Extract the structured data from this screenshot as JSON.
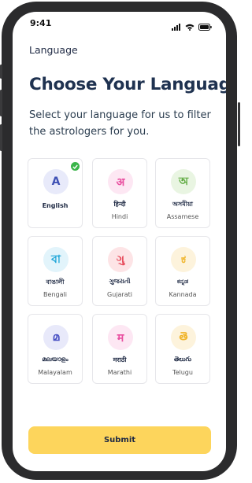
{
  "status_bar": {
    "time": "9:41"
  },
  "header": {
    "title": "Language"
  },
  "page": {
    "heading": "Choose Your Language",
    "subtitle": "Select your language for us to filter the astrologers for you."
  },
  "languages": [
    {
      "glyph": "A",
      "native": "",
      "english": "English",
      "selected": true,
      "accent": "#3f51b5",
      "bg": "#e8eafa"
    },
    {
      "glyph": "अ",
      "native": "हिन्दी",
      "english": "Hindi",
      "selected": false,
      "accent": "#e94fa0",
      "bg": "#fde7f3"
    },
    {
      "glyph": "অ",
      "native": "অসমীয়া",
      "english": "Assamese",
      "selected": false,
      "accent": "#5aa83b",
      "bg": "#e9f5e2"
    },
    {
      "glyph": "বা",
      "native": "বাঙালী",
      "english": "Bengali",
      "selected": false,
      "accent": "#1fa6d8",
      "bg": "#e2f4fb"
    },
    {
      "glyph": "ગુ",
      "native": "ગુજરાતી",
      "english": "Gujarati",
      "selected": false,
      "accent": "#e74c5c",
      "bg": "#fde4e6"
    },
    {
      "glyph": "ಕ",
      "native": "ಕನ್ನಡ",
      "english": "Kannada",
      "selected": false,
      "accent": "#f0b429",
      "bg": "#fdf3dc"
    },
    {
      "glyph": "മ",
      "native": "മലയാളം",
      "english": "Malayalam",
      "selected": false,
      "accent": "#4a52c4",
      "bg": "#e8e9fa"
    },
    {
      "glyph": "म",
      "native": "मराठी",
      "english": "Marathi",
      "selected": false,
      "accent": "#e94fa0",
      "bg": "#fde7f3"
    },
    {
      "glyph": "తె",
      "native": "తెలుగు",
      "english": "Telugu",
      "selected": false,
      "accent": "#f0b429",
      "bg": "#fdf3dc"
    }
  ],
  "actions": {
    "submit_label": "Submit"
  },
  "colors": {
    "submit_bg": "#fdd55c",
    "heading": "#1f3250",
    "check": "#3bb54a"
  }
}
